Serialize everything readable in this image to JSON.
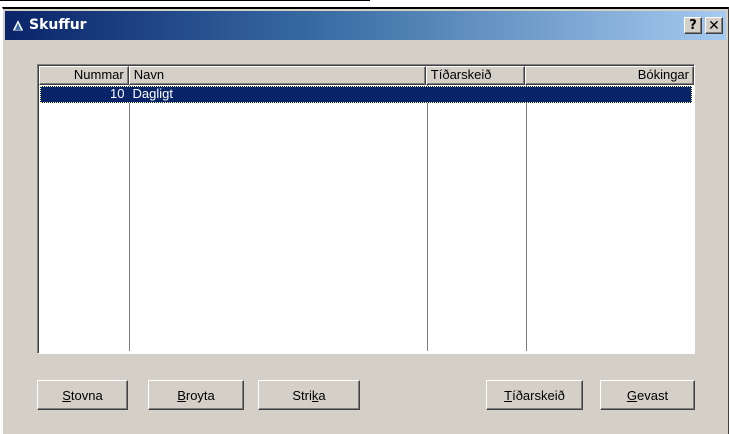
{
  "window": {
    "title": "Skuffur",
    "help_label": "?",
    "close_label": "✕"
  },
  "list": {
    "columns": [
      "Nummar",
      "Navn",
      "Tíðarskeið",
      "Bókingar"
    ],
    "rows": [
      {
        "nummar": "10",
        "navn": "Dagligt",
        "tidarskeid": "",
        "bokingar": ""
      }
    ],
    "selected_row": 0
  },
  "buttons": {
    "stovna": {
      "mnemonic": "S",
      "rest": "tovna"
    },
    "broyta": {
      "mnemonic": "B",
      "rest": "royta"
    },
    "strika": {
      "pre": "Stri",
      "mnemonic": "k",
      "rest": "a"
    },
    "tidarskeid": {
      "mnemonic": "T",
      "rest": "íðarskeið"
    },
    "gevast": {
      "mnemonic": "G",
      "rest": "evast"
    }
  },
  "colors": {
    "titlebar_start": "#0a246a",
    "titlebar_end": "#a6caf0",
    "selection": "#0a246a",
    "face": "#d4d0c8"
  },
  "icons": {
    "app": "triangle-warning-icon"
  }
}
